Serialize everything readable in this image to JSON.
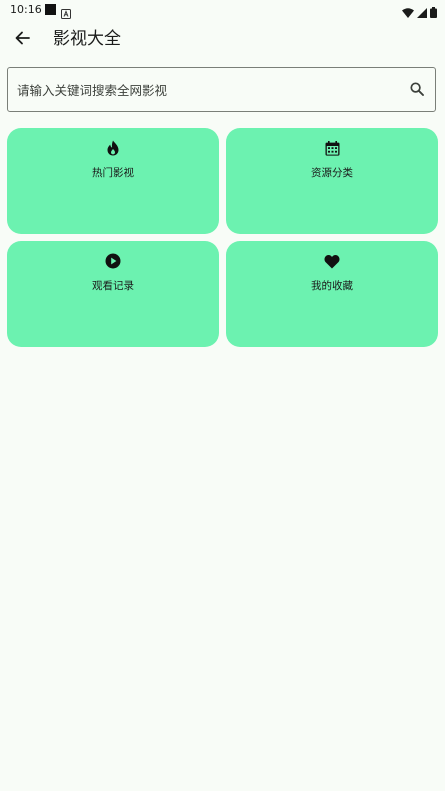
{
  "status_bar": {
    "time": "10:16"
  },
  "app_bar": {
    "title": "影视大全"
  },
  "search": {
    "placeholder": "请输入关键词搜索全网影视",
    "value": ""
  },
  "menu": {
    "items": [
      {
        "label": "热门影视",
        "icon": "fire-icon"
      },
      {
        "label": "资源分类",
        "icon": "calendar-icon"
      },
      {
        "label": "观看记录",
        "icon": "play-circle-icon"
      },
      {
        "label": "我的收藏",
        "icon": "heart-icon"
      }
    ]
  },
  "colors": {
    "background": "#f8fcf7",
    "card": "#6cf2b0",
    "text": "#1b1c1b"
  }
}
